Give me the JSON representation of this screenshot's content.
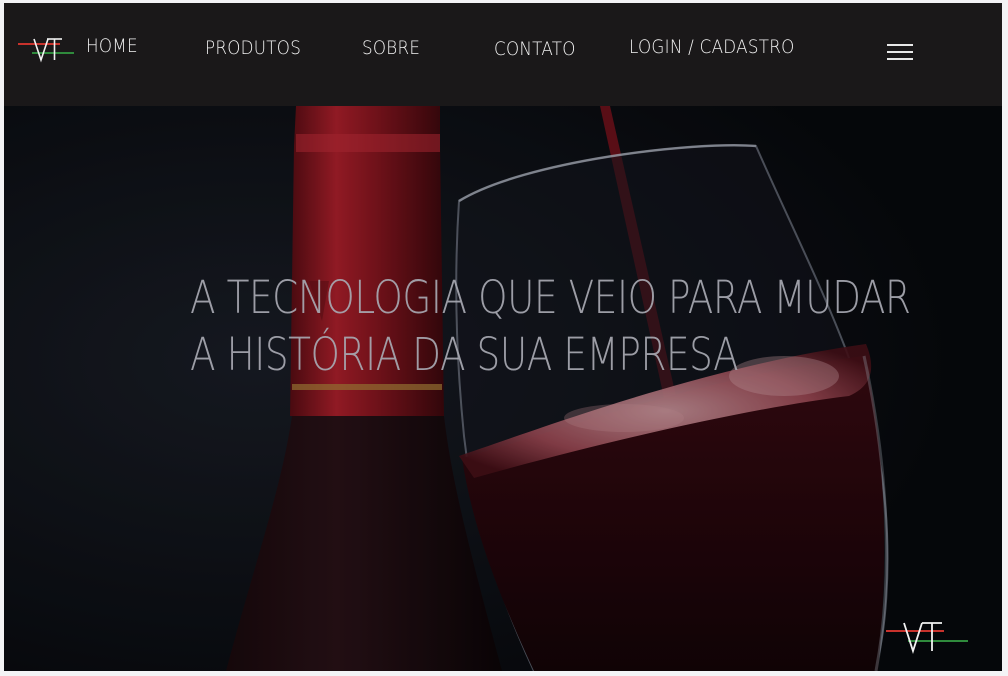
{
  "nav": {
    "logo_text": "VT",
    "links": [
      "HOME",
      "PRODUTOS",
      "SOBRE",
      "CONTATO",
      "LOGIN / CADASTRO"
    ],
    "menu_icon": "hamburger-menu-icon"
  },
  "hero": {
    "headline_line1": "A TECNOLOGIA QUE VEIO PARA MUDAR",
    "headline_line2": "A HISTÓRIA DA SUA EMPRESA",
    "corner_logo_text": "VT"
  },
  "colors": {
    "navbar": "#1a1819",
    "hero_background": "#0d0f14",
    "logo_red": "#c8322c",
    "logo_green": "#2f8a3c",
    "wine": "#8a1c24"
  }
}
